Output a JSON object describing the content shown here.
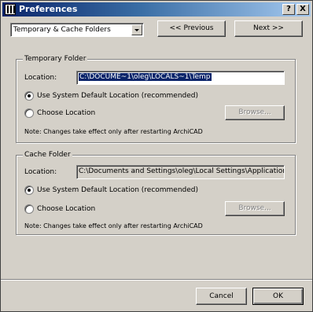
{
  "window": {
    "title": "Preferences"
  },
  "titlebar_buttons": {
    "help": "?",
    "close": "X"
  },
  "nav": {
    "page_select": "Temporary & Cache Folders",
    "previous": "<< Previous",
    "next": "Next >>"
  },
  "temporary": {
    "group_title": "Temporary Folder",
    "location_label": "Location:",
    "location_value": "C:\\DOCUME~1\\oleg\\LOCALS~1\\Temp",
    "option_default": "Use System Default Location (recommended)",
    "option_choose": "Choose Location",
    "browse": "Browse...",
    "note": "Note: Changes take effect only after restarting ArchiCAD"
  },
  "cache": {
    "group_title": "Cache Folder",
    "location_label": "Location:",
    "location_value": "C:\\Documents and Settings\\oleg\\Local Settings\\Application L",
    "option_default": "Use System Default Location (recommended)",
    "option_choose": "Choose Location",
    "browse": "Browse...",
    "note": "Note: Changes take effect only after restarting ArchiCAD"
  },
  "footer": {
    "cancel": "Cancel",
    "ok": "OK"
  }
}
